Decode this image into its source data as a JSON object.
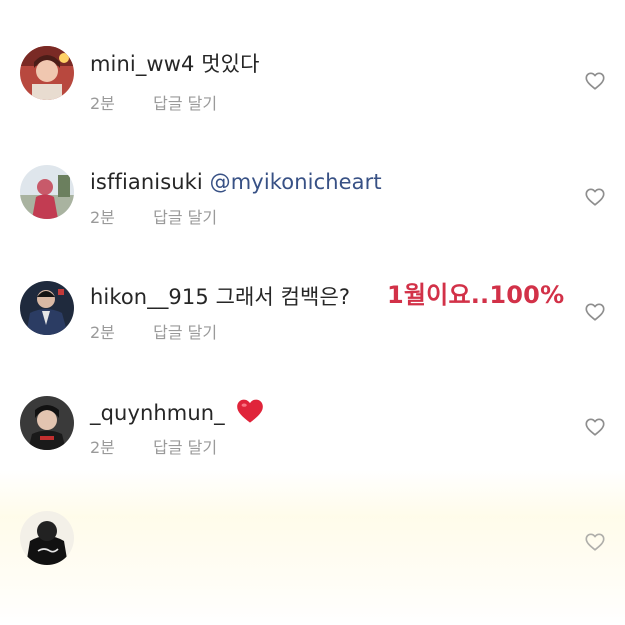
{
  "comments": [
    {
      "username": "mini_ww4",
      "text": "멋있다",
      "time": "2분",
      "reply_label": "답글 달기"
    },
    {
      "username": "isffianisuki",
      "mention": "@myikonicheart",
      "time": "2분",
      "reply_label": "답글 달기"
    },
    {
      "username": "hikon__915",
      "text": "그래서 컴백은?",
      "time": "2분",
      "reply_label": "답글 달기"
    },
    {
      "username": "_quynhmun_",
      "emoji": "heart",
      "time": "2분",
      "reply_label": "답글 달기"
    },
    {
      "username": ""
    }
  ],
  "annotation": {
    "text": "1월이요..100%",
    "color": "#d23148"
  },
  "icons": {
    "like": "heart-outline-icon"
  },
  "colors": {
    "text": "#262626",
    "meta": "#9a9a9a",
    "mention": "#385185",
    "heart_emoji": "#e0243a"
  }
}
